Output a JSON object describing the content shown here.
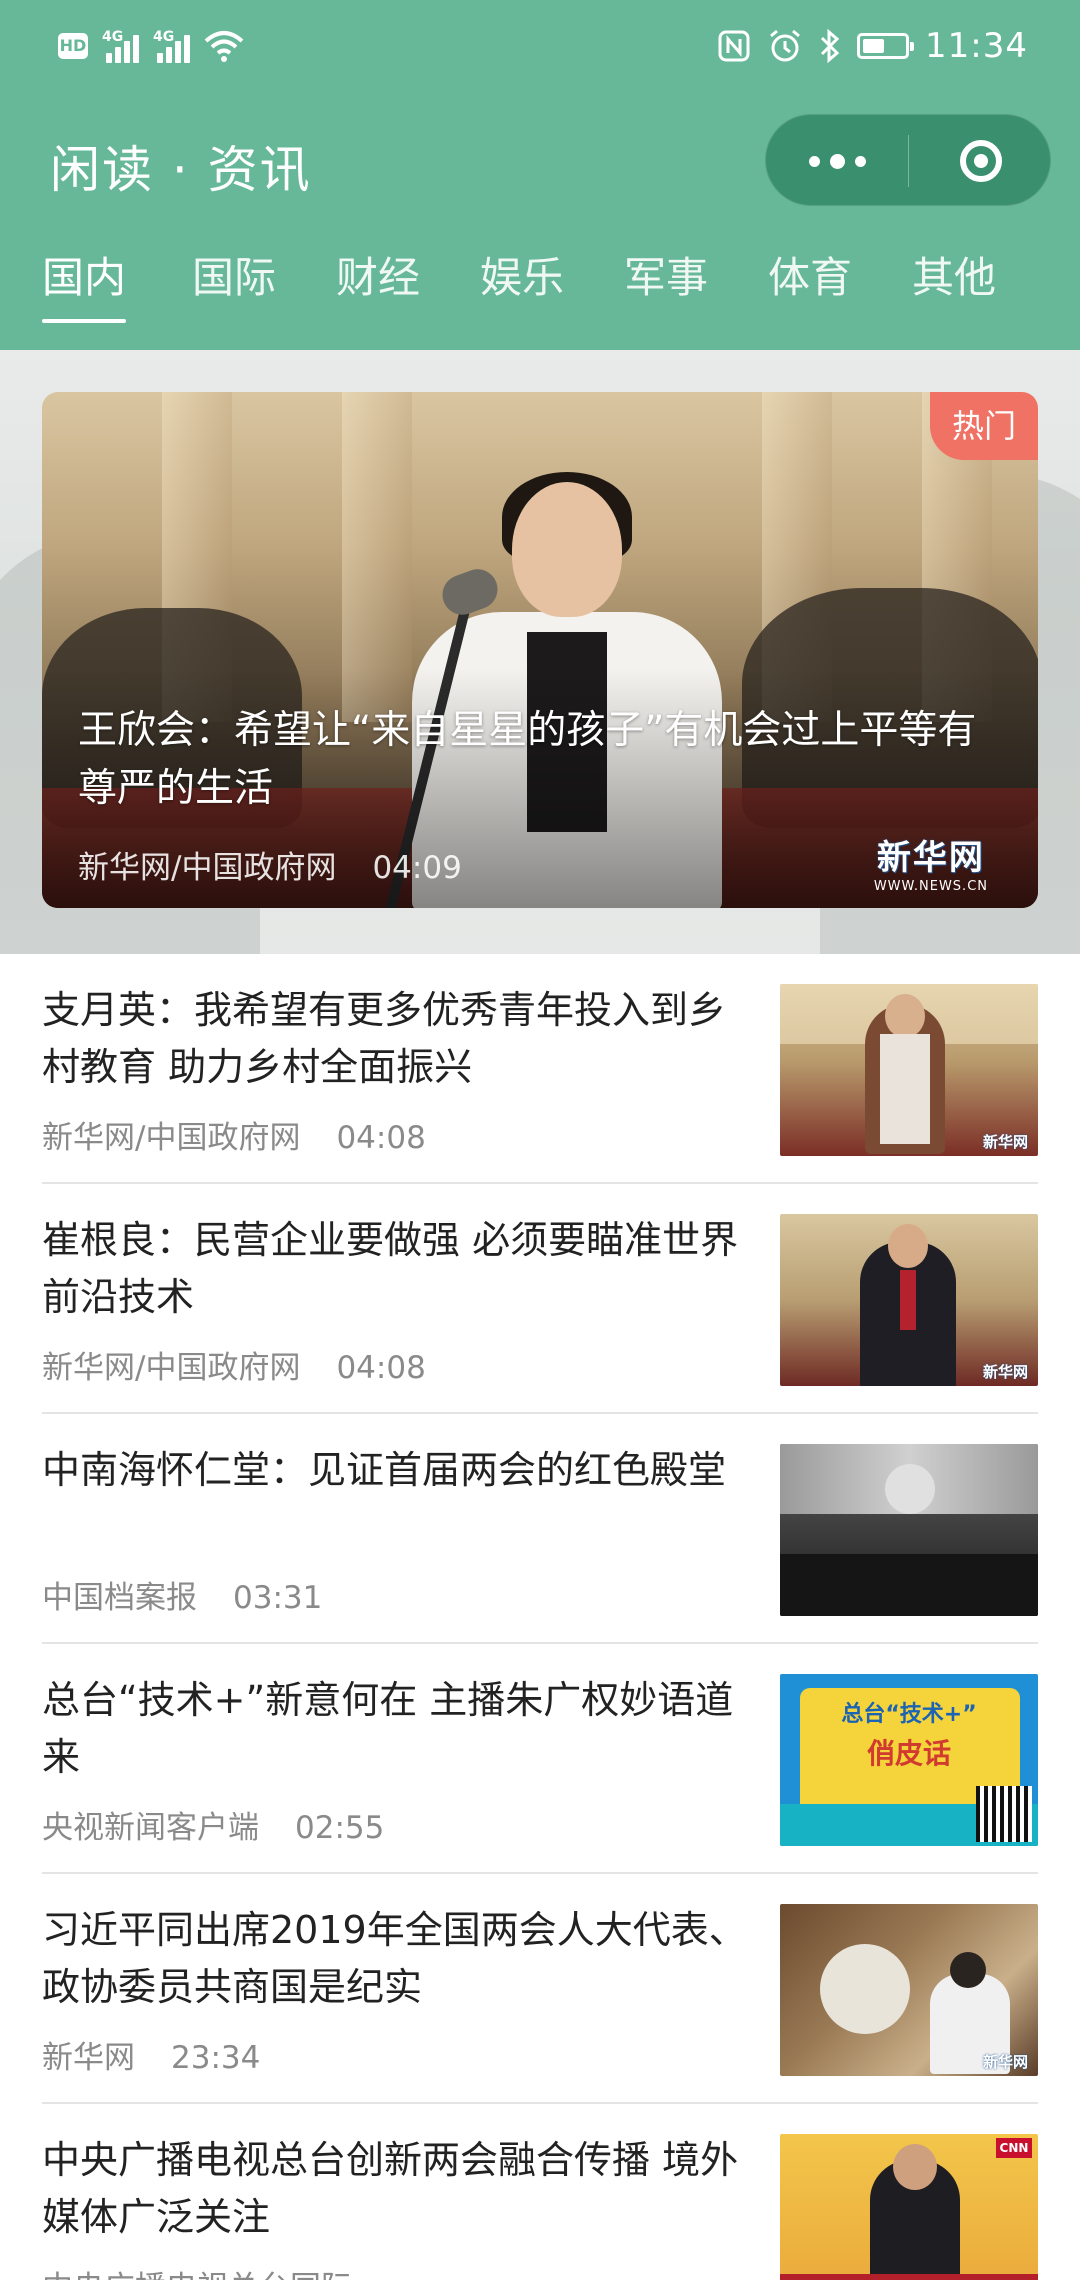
{
  "status_bar": {
    "hd": "HD",
    "net1": "4G",
    "net2": "4G",
    "time": "11:34"
  },
  "header": {
    "title": "闲读 · 资讯",
    "more_icon": "more-dots-icon",
    "close_icon": "target-close-icon"
  },
  "tabs": [
    {
      "label": "国内",
      "active": true
    },
    {
      "label": "国际"
    },
    {
      "label": "财经"
    },
    {
      "label": "娱乐"
    },
    {
      "label": "军事"
    },
    {
      "label": "体育"
    },
    {
      "label": "其他"
    }
  ],
  "hero": {
    "badge": "热门",
    "title": "王欣会：希望让“来自星星的孩子”有机会过上平等有尊严的生活",
    "source": "新华网/中国政府网",
    "time": "04:09",
    "watermark": "新华网",
    "watermark_sub": "WWW.NEWS.CN"
  },
  "news": [
    {
      "title": "支月英：我希望有更多优秀青年投入到乡村教育 助力乡村全面振兴",
      "source": "新华网/中国政府网",
      "time": "04:08",
      "thumb_watermark": "新华网"
    },
    {
      "title": "崔根良：民营企业要做强 必须要瞄准世界前沿技术",
      "source": "新华网/中国政府网",
      "time": "04:08",
      "thumb_watermark": "新华网"
    },
    {
      "title": "中南海怀仁堂：见证首届两会的红色殿堂",
      "source": "中国档案报",
      "time": "03:31"
    },
    {
      "title": "总台“技术+”新意何在 主播朱广权妙语道来",
      "source": "央视新闻客户端",
      "time": "02:55",
      "thumb_text1": "总台“技术+”",
      "thumb_text2": "俏皮话"
    },
    {
      "title": "习近平同出席2019年全国两会人大代表、政协委员共商国是纪实",
      "source": "新华网",
      "time": "23:34",
      "thumb_watermark": "新华网"
    },
    {
      "title": "中央广播电视总台创新两会融合传播 境外媒体广泛关注",
      "source": "中央广播电视总台国际",
      "time": "",
      "thumb_watermark": "CNN"
    }
  ],
  "colors": {
    "header_bg": "#66b898",
    "capsule_bg": "#3a8f6e",
    "hot_badge": "#ef7264",
    "title_text": "#222222",
    "meta_text": "#8a8a8a"
  }
}
